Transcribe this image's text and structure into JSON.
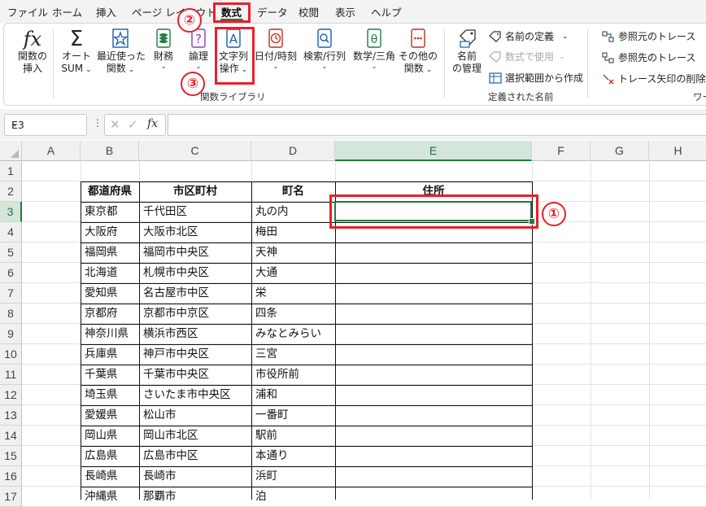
{
  "menu": {
    "tabs": [
      "ファイル",
      "ホーム",
      "挿入",
      "ページ レイアウト",
      "数式",
      "データ",
      "校閲",
      "表示",
      "ヘルプ"
    ],
    "active_tab": "数式"
  },
  "ribbon": {
    "function_library": {
      "label": "関数ライブラリ",
      "insert_function": [
        "関数の",
        "挿入"
      ],
      "autosum": [
        "オート",
        "SUM"
      ],
      "recently_used": [
        "最近使った",
        "関数"
      ],
      "financial": "財務",
      "logical": "論理",
      "text": [
        "文字列",
        "操作"
      ],
      "date_time": "日付/時刻",
      "lookup": "検索/行列",
      "math": "数学/三角",
      "more_functions": [
        "その他の",
        "関数"
      ]
    },
    "defined_names": {
      "label": "定義された名前",
      "name_manager": [
        "名前",
        "の管理"
      ],
      "define_name": "名前の定義",
      "use_in_formula": "数式で使用",
      "create_from_selection": "選択範囲から作成"
    },
    "formula_auditing": {
      "label_partial": "ワー",
      "trace_precedents": "参照元のトレース",
      "trace_dependents": "参照先のトレース",
      "remove_arrows": "トレース矢印の削除"
    }
  },
  "formula_bar": {
    "name_box": "E3",
    "fx": "fx",
    "content": ""
  },
  "sheet": {
    "columns": [
      "A",
      "B",
      "C",
      "D",
      "E",
      "F",
      "G",
      "H"
    ],
    "selected_column": "E",
    "rows": [
      "1",
      "2",
      "3",
      "4",
      "5",
      "6",
      "7",
      "8",
      "9",
      "10",
      "11",
      "12",
      "13",
      "14",
      "15",
      "16",
      "17"
    ],
    "selected_row": "3",
    "table_headers": [
      "都道府県",
      "市区町村",
      "町名",
      "住所"
    ],
    "table_rows": [
      [
        "東京都",
        "千代田区",
        "丸の内",
        ""
      ],
      [
        "大阪府",
        "大阪市北区",
        "梅田",
        ""
      ],
      [
        "福岡県",
        "福岡市中央区",
        "天神",
        ""
      ],
      [
        "北海道",
        "札幌市中央区",
        "大通",
        ""
      ],
      [
        "愛知県",
        "名古屋市中区",
        "栄",
        ""
      ],
      [
        "京都府",
        "京都市中京区",
        "四条",
        ""
      ],
      [
        "神奈川県",
        "横浜市西区",
        "みなとみらい",
        ""
      ],
      [
        "兵庫県",
        "神戸市中央区",
        "三宮",
        ""
      ],
      [
        "千葉県",
        "千葉市中央区",
        "市役所前",
        ""
      ],
      [
        "埼玉県",
        "さいたま市中央区",
        "浦和",
        ""
      ],
      [
        "愛媛県",
        "松山市",
        "一番町",
        ""
      ],
      [
        "岡山県",
        "岡山市北区",
        "駅前",
        ""
      ],
      [
        "広島県",
        "広島市中区",
        "本通り",
        ""
      ],
      [
        "長崎県",
        "長崎市",
        "浜町",
        ""
      ],
      [
        "沖縄県",
        "那覇市",
        "泊",
        ""
      ]
    ]
  },
  "annotations": {
    "step1": "①",
    "step2": "②",
    "step3": "③",
    "color": "#e8202a"
  },
  "colors": {
    "accent": "#1f7a43",
    "annotation": "#e8202a"
  }
}
